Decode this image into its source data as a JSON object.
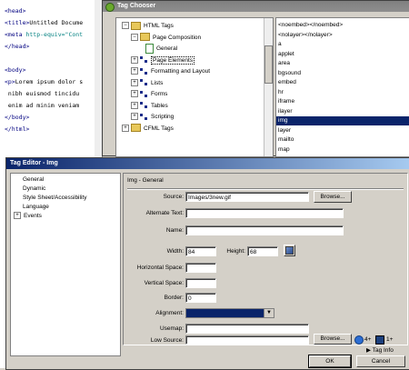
{
  "code_editor": {
    "lines": [
      {
        "tag": "<head>",
        "attr": "",
        "text": ""
      },
      {
        "tag": "<title>",
        "attr": "",
        "text": "Untitled Docume"
      },
      {
        "tag": "<meta ",
        "attr": "http-equiv=\"Cont",
        "text": ""
      },
      {
        "tag": "</head>",
        "attr": "",
        "text": ""
      },
      {
        "tag": "",
        "attr": "",
        "text": ""
      },
      {
        "tag": "<body>",
        "attr": "",
        "text": ""
      },
      {
        "tag": "<p>",
        "attr": "",
        "text": "Lorem ipsum dolor s"
      },
      {
        "tag": "",
        "attr": "",
        "text": "  nibh euismod tincidu"
      },
      {
        "tag": "",
        "attr": "",
        "text": "  enim ad minim veniam"
      },
      {
        "tag": "</body>",
        "attr": "",
        "text": ""
      },
      {
        "tag": "</html>",
        "attr": "",
        "text": ""
      }
    ]
  },
  "tag_chooser": {
    "title": "Tag Chooser",
    "tree": [
      {
        "label": "HTML Tags",
        "type": "folder",
        "expander": "−"
      },
      {
        "label": "Page Composition",
        "type": "folder",
        "expander": "−"
      },
      {
        "label": "General",
        "type": "doc",
        "expander": ""
      },
      {
        "label": "Page Elements",
        "type": "tag",
        "expander": "+"
      },
      {
        "label": "Formatting and Layout",
        "type": "tag",
        "expander": "+"
      },
      {
        "label": "Lists",
        "type": "tag",
        "expander": "+"
      },
      {
        "label": "Forms",
        "type": "tag",
        "expander": "+"
      },
      {
        "label": "Tables",
        "type": "tag",
        "expander": "+"
      },
      {
        "label": "Scripting",
        "type": "tag",
        "expander": "+"
      },
      {
        "label": "CFML Tags",
        "type": "folder",
        "expander": "+"
      }
    ],
    "tag_list": [
      "<noembed></noembed>",
      "<nolayer></nolayer>",
      "a",
      "applet",
      "area",
      "bgsound",
      "embed",
      "hr",
      "iframe",
      "ilayer",
      "img",
      "layer",
      "mailto",
      "map"
    ],
    "selected_tag": "img"
  },
  "tag_editor": {
    "title": "Tag Editor - Img",
    "categories": [
      {
        "label": "General",
        "expander": ""
      },
      {
        "label": "Dynamic",
        "expander": ""
      },
      {
        "label": "Style Sheet/Accessibility",
        "expander": ""
      },
      {
        "label": "Language",
        "expander": ""
      },
      {
        "label": "Events",
        "expander": "+"
      }
    ],
    "section_title": "Img - General",
    "labels": {
      "source": "Source:",
      "alt": "Alternate Text:",
      "name": "Name:",
      "width": "Width:",
      "height": "Height:",
      "hspace": "Horizontal Space:",
      "vspace": "Vertical Space:",
      "border": "Border:",
      "alignment": "Alignment:",
      "usemap": "Usemap:",
      "lowsrc": "Low Source:"
    },
    "values": {
      "source": "Images/3new.gif",
      "alt": "",
      "name": "",
      "width": "84",
      "height": "68",
      "hspace": "",
      "vspace": "",
      "border": "0",
      "usemap": "",
      "lowsrc": ""
    },
    "buttons": {
      "browse": "Browse...",
      "browse_low": "Browse...",
      "ok": "OK",
      "cancel": "Cancel"
    },
    "icon_labels": {
      "ie": "4+",
      "ns": "1+"
    },
    "tag_info": "Tag Info",
    "tag_info_arrow": "▶"
  }
}
